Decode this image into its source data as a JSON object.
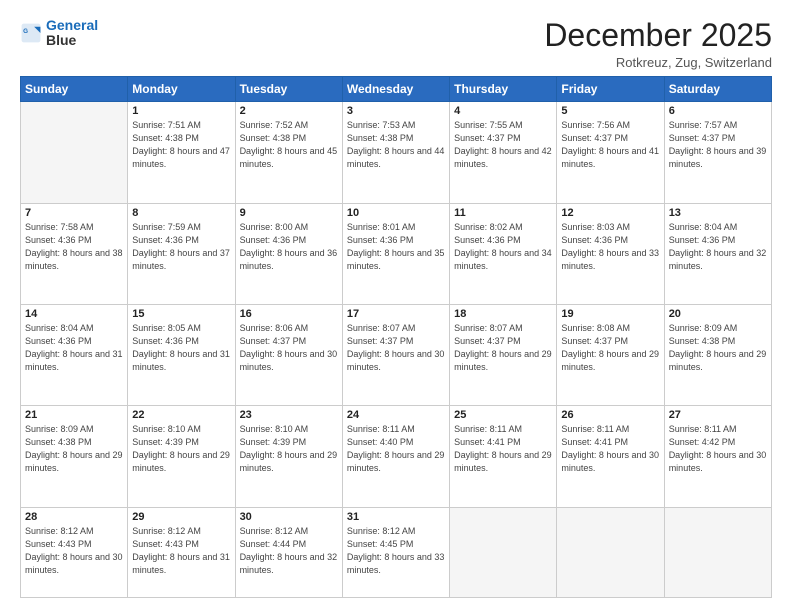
{
  "logo": {
    "line1": "General",
    "line2": "Blue"
  },
  "title": "December 2025",
  "location": "Rotkreuz, Zug, Switzerland",
  "days_header": [
    "Sunday",
    "Monday",
    "Tuesday",
    "Wednesday",
    "Thursday",
    "Friday",
    "Saturday"
  ],
  "weeks": [
    [
      {
        "num": "",
        "empty": true
      },
      {
        "num": "1",
        "sunrise": "7:51 AM",
        "sunset": "4:38 PM",
        "daylight": "8 hours and 47 minutes."
      },
      {
        "num": "2",
        "sunrise": "7:52 AM",
        "sunset": "4:38 PM",
        "daylight": "8 hours and 45 minutes."
      },
      {
        "num": "3",
        "sunrise": "7:53 AM",
        "sunset": "4:38 PM",
        "daylight": "8 hours and 44 minutes."
      },
      {
        "num": "4",
        "sunrise": "7:55 AM",
        "sunset": "4:37 PM",
        "daylight": "8 hours and 42 minutes."
      },
      {
        "num": "5",
        "sunrise": "7:56 AM",
        "sunset": "4:37 PM",
        "daylight": "8 hours and 41 minutes."
      },
      {
        "num": "6",
        "sunrise": "7:57 AM",
        "sunset": "4:37 PM",
        "daylight": "8 hours and 39 minutes."
      }
    ],
    [
      {
        "num": "7",
        "sunrise": "7:58 AM",
        "sunset": "4:36 PM",
        "daylight": "8 hours and 38 minutes."
      },
      {
        "num": "8",
        "sunrise": "7:59 AM",
        "sunset": "4:36 PM",
        "daylight": "8 hours and 37 minutes."
      },
      {
        "num": "9",
        "sunrise": "8:00 AM",
        "sunset": "4:36 PM",
        "daylight": "8 hours and 36 minutes."
      },
      {
        "num": "10",
        "sunrise": "8:01 AM",
        "sunset": "4:36 PM",
        "daylight": "8 hours and 35 minutes."
      },
      {
        "num": "11",
        "sunrise": "8:02 AM",
        "sunset": "4:36 PM",
        "daylight": "8 hours and 34 minutes."
      },
      {
        "num": "12",
        "sunrise": "8:03 AM",
        "sunset": "4:36 PM",
        "daylight": "8 hours and 33 minutes."
      },
      {
        "num": "13",
        "sunrise": "8:04 AM",
        "sunset": "4:36 PM",
        "daylight": "8 hours and 32 minutes."
      }
    ],
    [
      {
        "num": "14",
        "sunrise": "8:04 AM",
        "sunset": "4:36 PM",
        "daylight": "8 hours and 31 minutes."
      },
      {
        "num": "15",
        "sunrise": "8:05 AM",
        "sunset": "4:36 PM",
        "daylight": "8 hours and 31 minutes."
      },
      {
        "num": "16",
        "sunrise": "8:06 AM",
        "sunset": "4:37 PM",
        "daylight": "8 hours and 30 minutes."
      },
      {
        "num": "17",
        "sunrise": "8:07 AM",
        "sunset": "4:37 PM",
        "daylight": "8 hours and 30 minutes."
      },
      {
        "num": "18",
        "sunrise": "8:07 AM",
        "sunset": "4:37 PM",
        "daylight": "8 hours and 29 minutes."
      },
      {
        "num": "19",
        "sunrise": "8:08 AM",
        "sunset": "4:37 PM",
        "daylight": "8 hours and 29 minutes."
      },
      {
        "num": "20",
        "sunrise": "8:09 AM",
        "sunset": "4:38 PM",
        "daylight": "8 hours and 29 minutes."
      }
    ],
    [
      {
        "num": "21",
        "sunrise": "8:09 AM",
        "sunset": "4:38 PM",
        "daylight": "8 hours and 29 minutes."
      },
      {
        "num": "22",
        "sunrise": "8:10 AM",
        "sunset": "4:39 PM",
        "daylight": "8 hours and 29 minutes."
      },
      {
        "num": "23",
        "sunrise": "8:10 AM",
        "sunset": "4:39 PM",
        "daylight": "8 hours and 29 minutes."
      },
      {
        "num": "24",
        "sunrise": "8:11 AM",
        "sunset": "4:40 PM",
        "daylight": "8 hours and 29 minutes."
      },
      {
        "num": "25",
        "sunrise": "8:11 AM",
        "sunset": "4:41 PM",
        "daylight": "8 hours and 29 minutes."
      },
      {
        "num": "26",
        "sunrise": "8:11 AM",
        "sunset": "4:41 PM",
        "daylight": "8 hours and 30 minutes."
      },
      {
        "num": "27",
        "sunrise": "8:11 AM",
        "sunset": "4:42 PM",
        "daylight": "8 hours and 30 minutes."
      }
    ],
    [
      {
        "num": "28",
        "sunrise": "8:12 AM",
        "sunset": "4:43 PM",
        "daylight": "8 hours and 30 minutes."
      },
      {
        "num": "29",
        "sunrise": "8:12 AM",
        "sunset": "4:43 PM",
        "daylight": "8 hours and 31 minutes."
      },
      {
        "num": "30",
        "sunrise": "8:12 AM",
        "sunset": "4:44 PM",
        "daylight": "8 hours and 32 minutes."
      },
      {
        "num": "31",
        "sunrise": "8:12 AM",
        "sunset": "4:45 PM",
        "daylight": "8 hours and 33 minutes."
      },
      {
        "num": "",
        "empty": true
      },
      {
        "num": "",
        "empty": true
      },
      {
        "num": "",
        "empty": true
      }
    ]
  ]
}
